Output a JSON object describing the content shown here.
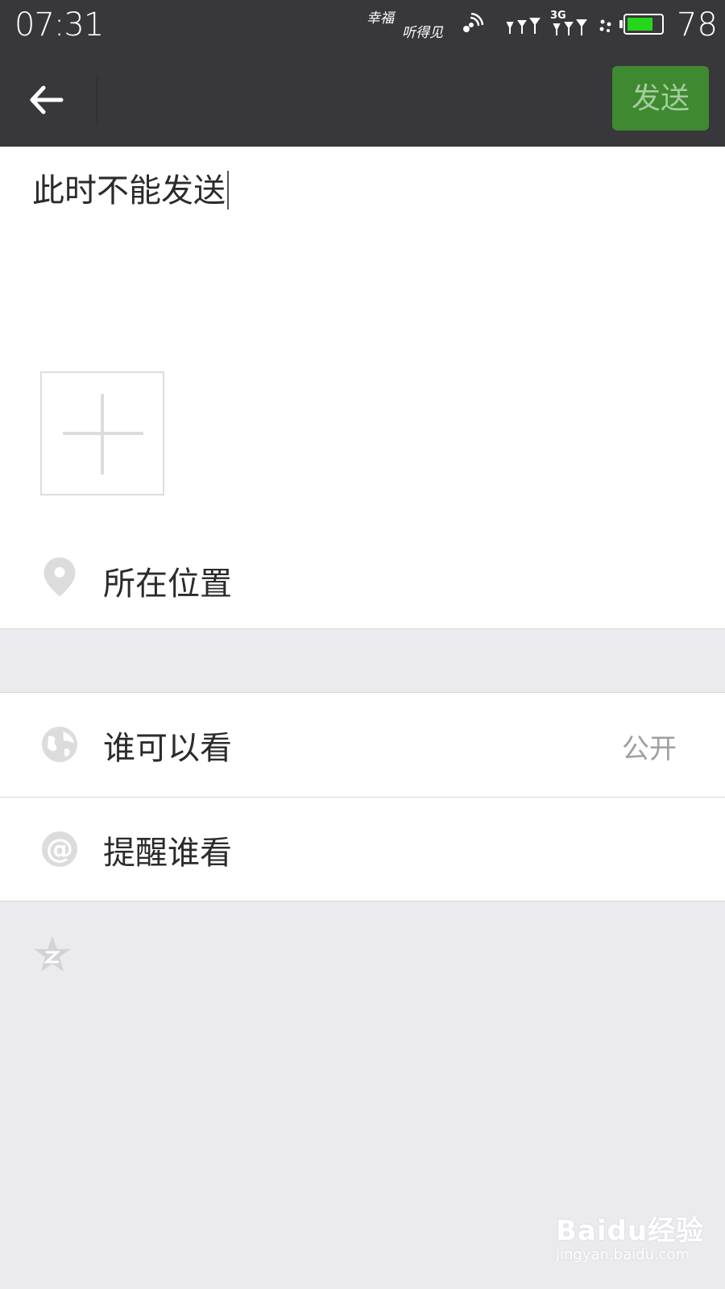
{
  "status_bar": {
    "time": "07:31",
    "carrier_line1": "幸福",
    "carrier_line2": "听得见",
    "battery_level": "78",
    "battery_fraction": 0.78,
    "network_label": "3G",
    "battery_color": "#27d61a"
  },
  "top_bar": {
    "send_label": "发送",
    "send_button_color": "#3f8a30"
  },
  "compose": {
    "text": "此时不能发送"
  },
  "options": {
    "location_label": "所在位置",
    "visibility_label": "谁可以看",
    "visibility_value": "公开",
    "mention_label": "提醒谁看"
  },
  "watermark": {
    "main": "Baidu经验",
    "sub": "jingyan.baidu.com"
  }
}
